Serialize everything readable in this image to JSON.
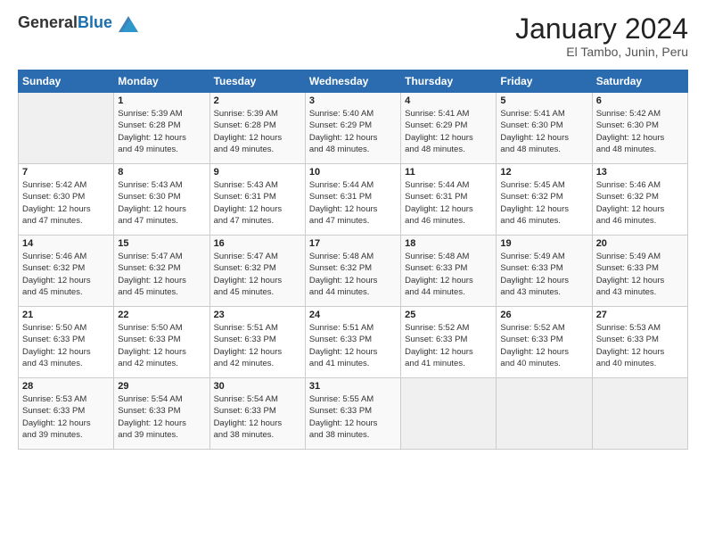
{
  "header": {
    "logo_general": "General",
    "logo_blue": "Blue",
    "month_title": "January 2024",
    "location": "El Tambo, Junin, Peru"
  },
  "days_of_week": [
    "Sunday",
    "Monday",
    "Tuesday",
    "Wednesday",
    "Thursday",
    "Friday",
    "Saturday"
  ],
  "weeks": [
    [
      {
        "num": "",
        "info": ""
      },
      {
        "num": "1",
        "info": "Sunrise: 5:39 AM\nSunset: 6:28 PM\nDaylight: 12 hours\nand 49 minutes."
      },
      {
        "num": "2",
        "info": "Sunrise: 5:39 AM\nSunset: 6:28 PM\nDaylight: 12 hours\nand 49 minutes."
      },
      {
        "num": "3",
        "info": "Sunrise: 5:40 AM\nSunset: 6:29 PM\nDaylight: 12 hours\nand 48 minutes."
      },
      {
        "num": "4",
        "info": "Sunrise: 5:41 AM\nSunset: 6:29 PM\nDaylight: 12 hours\nand 48 minutes."
      },
      {
        "num": "5",
        "info": "Sunrise: 5:41 AM\nSunset: 6:30 PM\nDaylight: 12 hours\nand 48 minutes."
      },
      {
        "num": "6",
        "info": "Sunrise: 5:42 AM\nSunset: 6:30 PM\nDaylight: 12 hours\nand 48 minutes."
      }
    ],
    [
      {
        "num": "7",
        "info": "Sunrise: 5:42 AM\nSunset: 6:30 PM\nDaylight: 12 hours\nand 47 minutes."
      },
      {
        "num": "8",
        "info": "Sunrise: 5:43 AM\nSunset: 6:30 PM\nDaylight: 12 hours\nand 47 minutes."
      },
      {
        "num": "9",
        "info": "Sunrise: 5:43 AM\nSunset: 6:31 PM\nDaylight: 12 hours\nand 47 minutes."
      },
      {
        "num": "10",
        "info": "Sunrise: 5:44 AM\nSunset: 6:31 PM\nDaylight: 12 hours\nand 47 minutes."
      },
      {
        "num": "11",
        "info": "Sunrise: 5:44 AM\nSunset: 6:31 PM\nDaylight: 12 hours\nand 46 minutes."
      },
      {
        "num": "12",
        "info": "Sunrise: 5:45 AM\nSunset: 6:32 PM\nDaylight: 12 hours\nand 46 minutes."
      },
      {
        "num": "13",
        "info": "Sunrise: 5:46 AM\nSunset: 6:32 PM\nDaylight: 12 hours\nand 46 minutes."
      }
    ],
    [
      {
        "num": "14",
        "info": "Sunrise: 5:46 AM\nSunset: 6:32 PM\nDaylight: 12 hours\nand 45 minutes."
      },
      {
        "num": "15",
        "info": "Sunrise: 5:47 AM\nSunset: 6:32 PM\nDaylight: 12 hours\nand 45 minutes."
      },
      {
        "num": "16",
        "info": "Sunrise: 5:47 AM\nSunset: 6:32 PM\nDaylight: 12 hours\nand 45 minutes."
      },
      {
        "num": "17",
        "info": "Sunrise: 5:48 AM\nSunset: 6:32 PM\nDaylight: 12 hours\nand 44 minutes."
      },
      {
        "num": "18",
        "info": "Sunrise: 5:48 AM\nSunset: 6:33 PM\nDaylight: 12 hours\nand 44 minutes."
      },
      {
        "num": "19",
        "info": "Sunrise: 5:49 AM\nSunset: 6:33 PM\nDaylight: 12 hours\nand 43 minutes."
      },
      {
        "num": "20",
        "info": "Sunrise: 5:49 AM\nSunset: 6:33 PM\nDaylight: 12 hours\nand 43 minutes."
      }
    ],
    [
      {
        "num": "21",
        "info": "Sunrise: 5:50 AM\nSunset: 6:33 PM\nDaylight: 12 hours\nand 43 minutes."
      },
      {
        "num": "22",
        "info": "Sunrise: 5:50 AM\nSunset: 6:33 PM\nDaylight: 12 hours\nand 42 minutes."
      },
      {
        "num": "23",
        "info": "Sunrise: 5:51 AM\nSunset: 6:33 PM\nDaylight: 12 hours\nand 42 minutes."
      },
      {
        "num": "24",
        "info": "Sunrise: 5:51 AM\nSunset: 6:33 PM\nDaylight: 12 hours\nand 41 minutes."
      },
      {
        "num": "25",
        "info": "Sunrise: 5:52 AM\nSunset: 6:33 PM\nDaylight: 12 hours\nand 41 minutes."
      },
      {
        "num": "26",
        "info": "Sunrise: 5:52 AM\nSunset: 6:33 PM\nDaylight: 12 hours\nand 40 minutes."
      },
      {
        "num": "27",
        "info": "Sunrise: 5:53 AM\nSunset: 6:33 PM\nDaylight: 12 hours\nand 40 minutes."
      }
    ],
    [
      {
        "num": "28",
        "info": "Sunrise: 5:53 AM\nSunset: 6:33 PM\nDaylight: 12 hours\nand 39 minutes."
      },
      {
        "num": "29",
        "info": "Sunrise: 5:54 AM\nSunset: 6:33 PM\nDaylight: 12 hours\nand 39 minutes."
      },
      {
        "num": "30",
        "info": "Sunrise: 5:54 AM\nSunset: 6:33 PM\nDaylight: 12 hours\nand 38 minutes."
      },
      {
        "num": "31",
        "info": "Sunrise: 5:55 AM\nSunset: 6:33 PM\nDaylight: 12 hours\nand 38 minutes."
      },
      {
        "num": "",
        "info": ""
      },
      {
        "num": "",
        "info": ""
      },
      {
        "num": "",
        "info": ""
      }
    ]
  ]
}
